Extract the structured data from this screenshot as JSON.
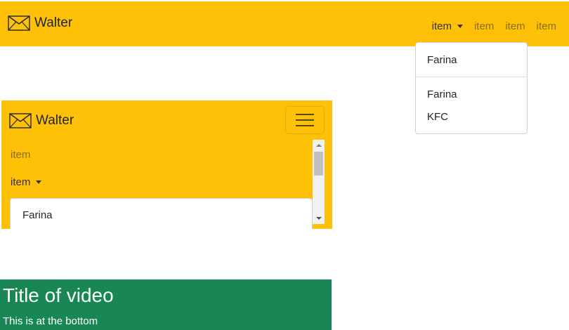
{
  "top_navbar": {
    "brand_label": "Walter",
    "brand_icon": "envelope-icon",
    "bg_color": "#ffc107",
    "links": [
      {
        "label": "item",
        "dropdown": true
      },
      {
        "label": "item"
      },
      {
        "label": "item"
      },
      {
        "label": "item"
      }
    ],
    "dropdown": {
      "items": [
        "Farina",
        "Farina",
        "KFC"
      ]
    }
  },
  "collapsed_navbar": {
    "brand_label": "Walter",
    "brand_icon": "envelope-icon",
    "toggler_icon": "hamburger-icon",
    "links": [
      {
        "label": "item"
      },
      {
        "label": "item",
        "dropdown": true
      }
    ],
    "dropdown": {
      "items": [
        "Farina"
      ]
    }
  },
  "video": {
    "title": "Title of video",
    "subtitle": "This is at the bottom",
    "bg_color": "#198754"
  }
}
